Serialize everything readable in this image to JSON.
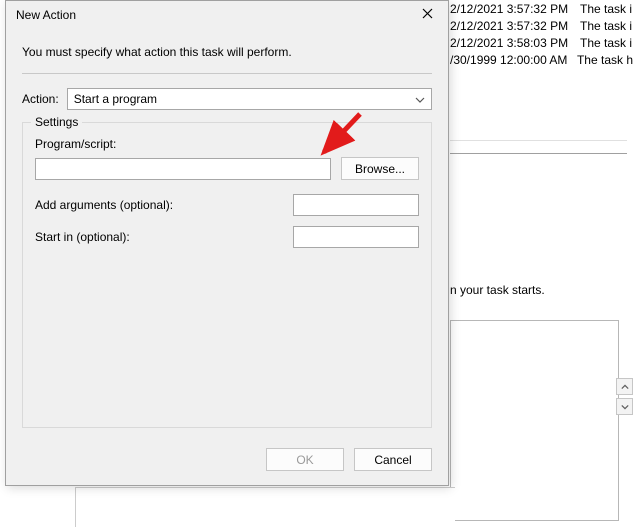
{
  "bg": {
    "rows": [
      {
        "date": "2/12/2021 3:57:32 PM",
        "desc": "The task i"
      },
      {
        "date": "2/12/2021 3:57:32 PM",
        "desc": "The task i"
      },
      {
        "date": "2/12/2021 3:58:03 PM",
        "desc": "The task i"
      },
      {
        "date": "/30/1999 12:00:00 AM",
        "desc": "The task h"
      }
    ],
    "mid_text": "n your task starts."
  },
  "dialog": {
    "title": "New Action",
    "description": "You must specify what action this task will perform.",
    "action_label": "Action:",
    "action_value": "Start a program",
    "settings_legend": "Settings",
    "program_label": "Program/script:",
    "program_value": "",
    "browse_label": "Browse...",
    "args_label": "Add arguments (optional):",
    "args_value": "",
    "startin_label": "Start in (optional):",
    "startin_value": "",
    "ok_label": "OK",
    "cancel_label": "Cancel"
  }
}
